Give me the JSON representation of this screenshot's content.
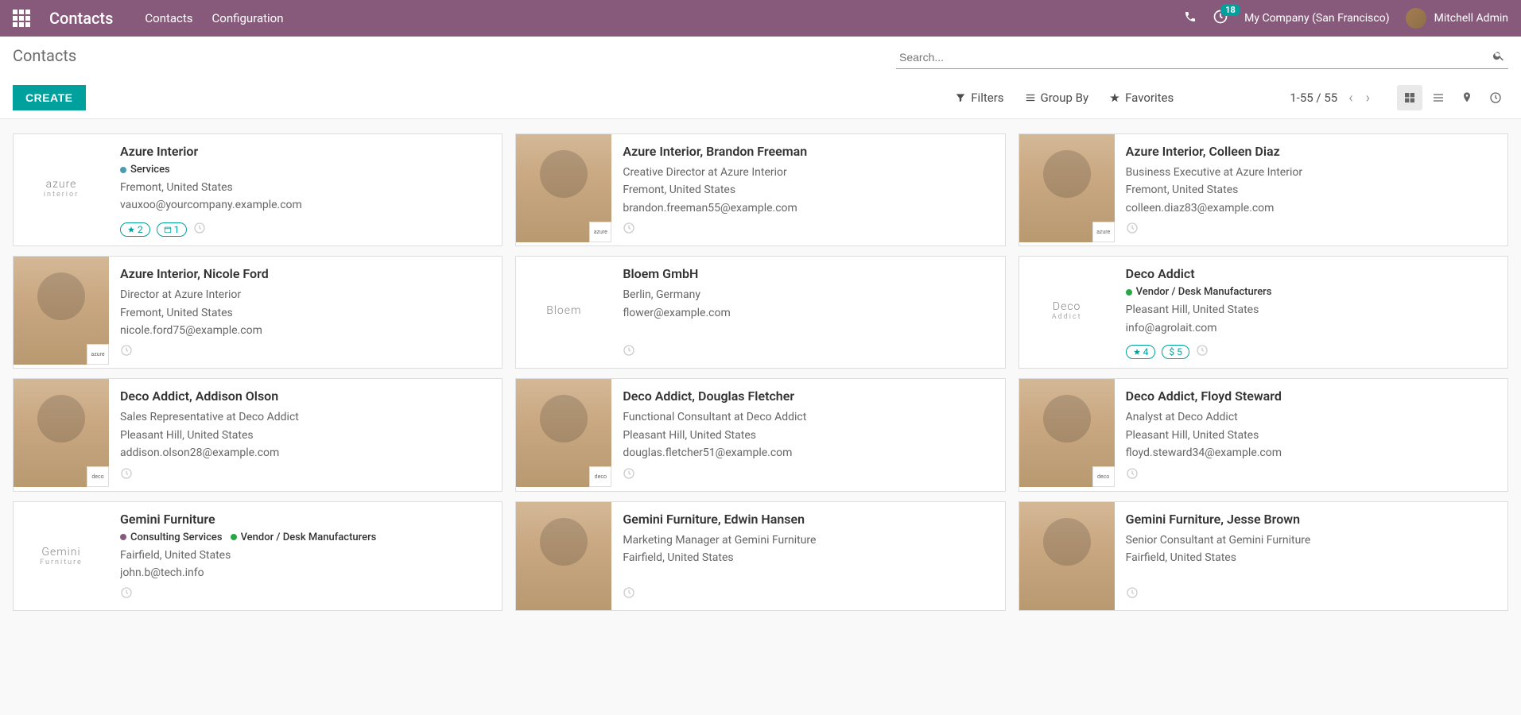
{
  "header": {
    "brand": "Contacts",
    "nav": [
      "Contacts",
      "Configuration"
    ],
    "notif_count": "18",
    "company": "My Company (San Francisco)",
    "user": "Mitchell Admin"
  },
  "breadcrumb": "Contacts",
  "search": {
    "placeholder": "Search..."
  },
  "buttons": {
    "create": "CREATE"
  },
  "filters": {
    "filters": "Filters",
    "groupby": "Group By",
    "favorites": "Favorites"
  },
  "pager": "1-55 / 55",
  "tag_colors": {
    "services": "#4b9bb5",
    "vendor": "#28a745",
    "consulting": "#875a7b"
  },
  "contacts": [
    {
      "name": "Azure Interior",
      "image_type": "logo",
      "logo_text": "azure",
      "logo_sub": "interior",
      "tags": [
        {
          "label": "Services",
          "color_key": "services"
        }
      ],
      "location": "Fremont, United States",
      "email": "vauxoo@yourcompany.example.com",
      "pills": [
        {
          "icon": "star",
          "text": "2"
        },
        {
          "icon": "calendar",
          "text": "1"
        }
      ],
      "company_badge": null
    },
    {
      "name": "Azure Interior, Brandon Freeman",
      "image_type": "person",
      "role": "Creative Director at Azure Interior",
      "location": "Fremont, United States",
      "email": "brandon.freeman55@example.com",
      "company_badge": "azure"
    },
    {
      "name": "Azure Interior, Colleen Diaz",
      "image_type": "person",
      "role": "Business Executive at Azure Interior",
      "location": "Fremont, United States",
      "email": "colleen.diaz83@example.com",
      "company_badge": "azure"
    },
    {
      "name": "Azure Interior, Nicole Ford",
      "image_type": "person",
      "role": "Director at Azure Interior",
      "location": "Fremont, United States",
      "email": "nicole.ford75@example.com",
      "company_badge": "azure"
    },
    {
      "name": "Bloem GmbH",
      "image_type": "logo",
      "logo_text": "Bloem",
      "location": "Berlin, Germany",
      "email": "flower@example.com",
      "company_badge": null
    },
    {
      "name": "Deco Addict",
      "image_type": "logo",
      "logo_text": "Deco",
      "logo_sub": "Addict",
      "tags": [
        {
          "label": "Vendor / Desk Manufacturers",
          "color_key": "vendor"
        }
      ],
      "location": "Pleasant Hill, United States",
      "email": "info@agrolait.com",
      "pills": [
        {
          "icon": "star",
          "text": "4"
        },
        {
          "icon": "dollar",
          "text": "$ 5"
        }
      ],
      "company_badge": null
    },
    {
      "name": "Deco Addict, Addison Olson",
      "image_type": "person",
      "role": "Sales Representative at Deco Addict",
      "location": "Pleasant Hill, United States",
      "email": "addison.olson28@example.com",
      "company_badge": "deco"
    },
    {
      "name": "Deco Addict, Douglas Fletcher",
      "image_type": "person",
      "role": "Functional Consultant at Deco Addict",
      "location": "Pleasant Hill, United States",
      "email": "douglas.fletcher51@example.com",
      "company_badge": "deco"
    },
    {
      "name": "Deco Addict, Floyd Steward",
      "image_type": "person",
      "role": "Analyst at Deco Addict",
      "location": "Pleasant Hill, United States",
      "email": "floyd.steward34@example.com",
      "company_badge": "deco"
    },
    {
      "name": "Gemini Furniture",
      "image_type": "logo",
      "logo_text": "Gemini",
      "logo_sub": "Furniture",
      "tags": [
        {
          "label": "Consulting Services",
          "color_key": "consulting"
        },
        {
          "label": "Vendor / Desk Manufacturers",
          "color_key": "vendor"
        }
      ],
      "location": "Fairfield, United States",
      "email": "john.b@tech.info",
      "company_badge": null
    },
    {
      "name": "Gemini Furniture, Edwin Hansen",
      "image_type": "person",
      "role": "Marketing Manager at Gemini Furniture",
      "location": "Fairfield, United States",
      "email": "",
      "company_badge": null
    },
    {
      "name": "Gemini Furniture, Jesse Brown",
      "image_type": "person",
      "role": "Senior Consultant at Gemini Furniture",
      "location": "Fairfield, United States",
      "email": "",
      "company_badge": null
    }
  ]
}
